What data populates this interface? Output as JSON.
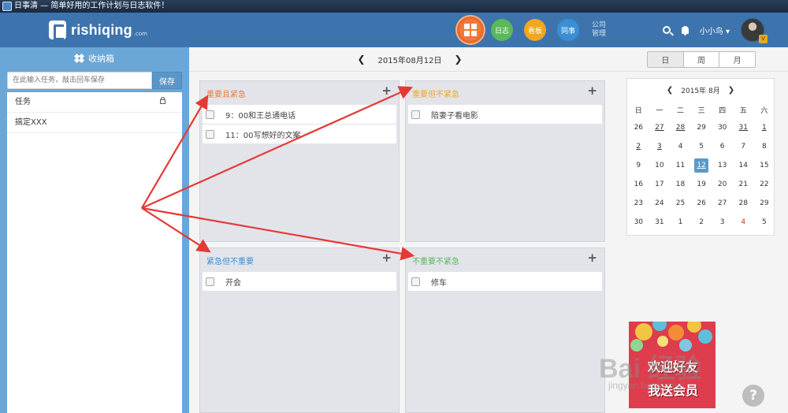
{
  "window": {
    "title": "日事清 — 简单好用的工作计划与日志软件！"
  },
  "header": {
    "logo_text": "rishiqing",
    "logo_sub": ".com",
    "nav": {
      "dashboard_icon": "grid-icon",
      "rizhi": "日志",
      "kanban": "看板",
      "tongshi": "同事",
      "company_line1": "公司",
      "company_line2": "管理"
    },
    "username": "小小鸟",
    "username_caret": "▾",
    "vip_badge": "V"
  },
  "inbox": {
    "title": "收纳箱",
    "input_placeholder": "在此输入任务，敲击回车保存",
    "save_label": "保存",
    "items": [
      {
        "label": "任务"
      },
      {
        "label": "搞定XXX"
      }
    ]
  },
  "datebar": {
    "prev": "❮",
    "date": "2015年08月12日",
    "next": "❯"
  },
  "view_tabs": [
    "日",
    "周",
    "月"
  ],
  "quadrants": {
    "q1": {
      "title": "重要且紧急",
      "color": "#f07a3a",
      "items": [
        "9：00和王总通电话",
        "11：00写想好的文案"
      ]
    },
    "q2": {
      "title": "重要但不紧急",
      "color": "#f0a81f",
      "items": [
        "陪妻子看电影"
      ]
    },
    "q3": {
      "title": "紧急但不重要",
      "color": "#3a8fd4",
      "items": [
        "开会"
      ]
    },
    "q4": {
      "title": "不重要不紧急",
      "color": "#5bb85b",
      "items": [
        "修车"
      ]
    },
    "add_label": "+"
  },
  "calendar": {
    "prev": "❮",
    "title": "2015年  8月",
    "next": "❯",
    "weekdays": [
      "日",
      "一",
      "二",
      "三",
      "四",
      "五",
      "六"
    ],
    "rows": [
      [
        "26",
        "27",
        "28",
        "29",
        "30",
        "31",
        "1"
      ],
      [
        "2",
        "3",
        "4",
        "5",
        "6",
        "7",
        "8"
      ],
      [
        "9",
        "10",
        "11",
        "12",
        "13",
        "14",
        "15"
      ],
      [
        "16",
        "17",
        "18",
        "19",
        "20",
        "21",
        "22"
      ],
      [
        "23",
        "24",
        "25",
        "26",
        "27",
        "28",
        "29"
      ],
      [
        "30",
        "31",
        "1",
        "2",
        "3",
        "4",
        "5"
      ]
    ],
    "today": "12"
  },
  "promo": {
    "line1": "欢迎好友",
    "line2": "我送会员"
  },
  "help_label": "?",
  "watermark": {
    "line1": "Bai 经验",
    "line2": "jingyan.baidu.com"
  }
}
